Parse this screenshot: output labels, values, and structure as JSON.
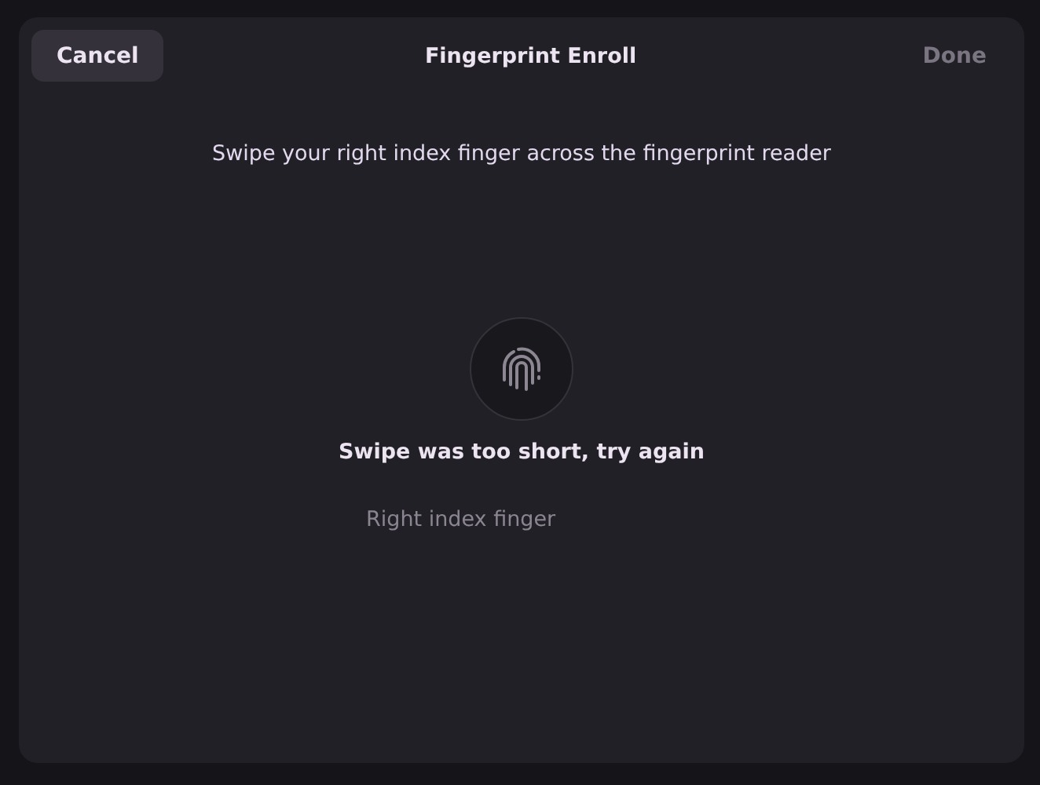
{
  "dialog": {
    "title": "Fingerprint Enroll",
    "cancel_button": {
      "label": "Cancel",
      "disabled": false
    },
    "done_button": {
      "label": "Done",
      "disabled": true
    },
    "instruction": "Swipe your right index finger across the fingerprint reader",
    "status": "Swipe was too short, try again",
    "finger_label": "Right index finger"
  }
}
